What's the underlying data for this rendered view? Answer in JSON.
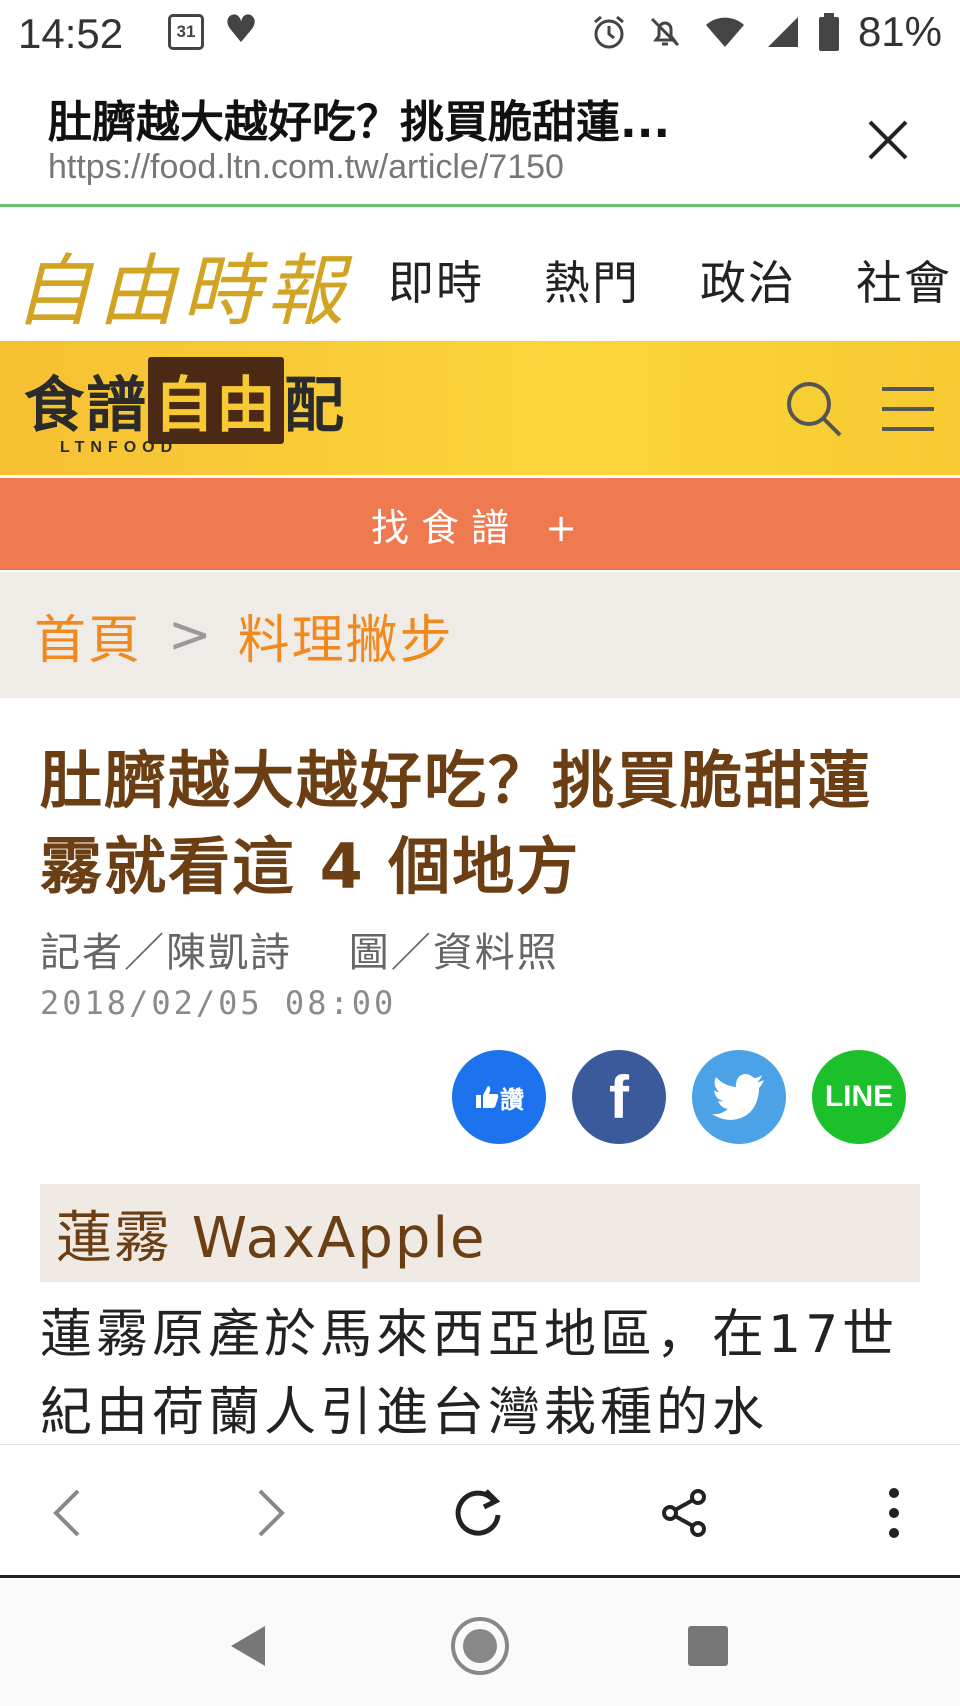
{
  "status_bar": {
    "time": "14:52",
    "calendar_day": "31",
    "battery_percent": "81%",
    "icons": [
      "calendar-icon",
      "heart-icon",
      "alarm-icon",
      "mute-icon",
      "wifi-icon",
      "signal-icon",
      "battery-icon"
    ]
  },
  "tab": {
    "title": "肚臍越大越好吃？挑買脆甜蓮...",
    "url": "https://food.ltn.com.tw/article/7150",
    "close_icon": "close-icon"
  },
  "site_nav": {
    "logo": "自由時報",
    "items": [
      "即時",
      "熱門",
      "政治",
      "社會"
    ]
  },
  "food_banner": {
    "logo_main": "食譜",
    "logo_box": "自由",
    "logo_end": "配",
    "logo_sub": "LTNFOOD",
    "search_icon": "search-icon",
    "menu_icon": "menu-icon"
  },
  "find_bar": {
    "label": "找食譜 +"
  },
  "breadcrumb": {
    "home": "首頁",
    "separator": ">",
    "category": "料理撇步"
  },
  "article": {
    "title": "肚臍越大越好吃？挑買脆甜蓮霧就看這 4 個地方",
    "byline": "記者／陳凱詩　 圖／資料照",
    "date": "2018/02/05 08:00",
    "share": {
      "like_label": "讚",
      "facebook_label": "f",
      "line_label": "LINE"
    },
    "section_heading": "蓮霧 WaxApple",
    "body": "蓮霧原產於馬來西亞地區，在17世紀由荷蘭人引進台灣栽種的水"
  },
  "browser_toolbar": {
    "icons": [
      "back-icon",
      "forward-icon",
      "reload-icon",
      "share-icon",
      "more-icon"
    ]
  },
  "colors": {
    "banner_yellow": "#f9cf36",
    "find_bar_orange": "#ef7a4f",
    "breadcrumb_orange": "#f08a1e",
    "title_brown": "#6b3e14",
    "divider_green": "#6cc26c"
  }
}
